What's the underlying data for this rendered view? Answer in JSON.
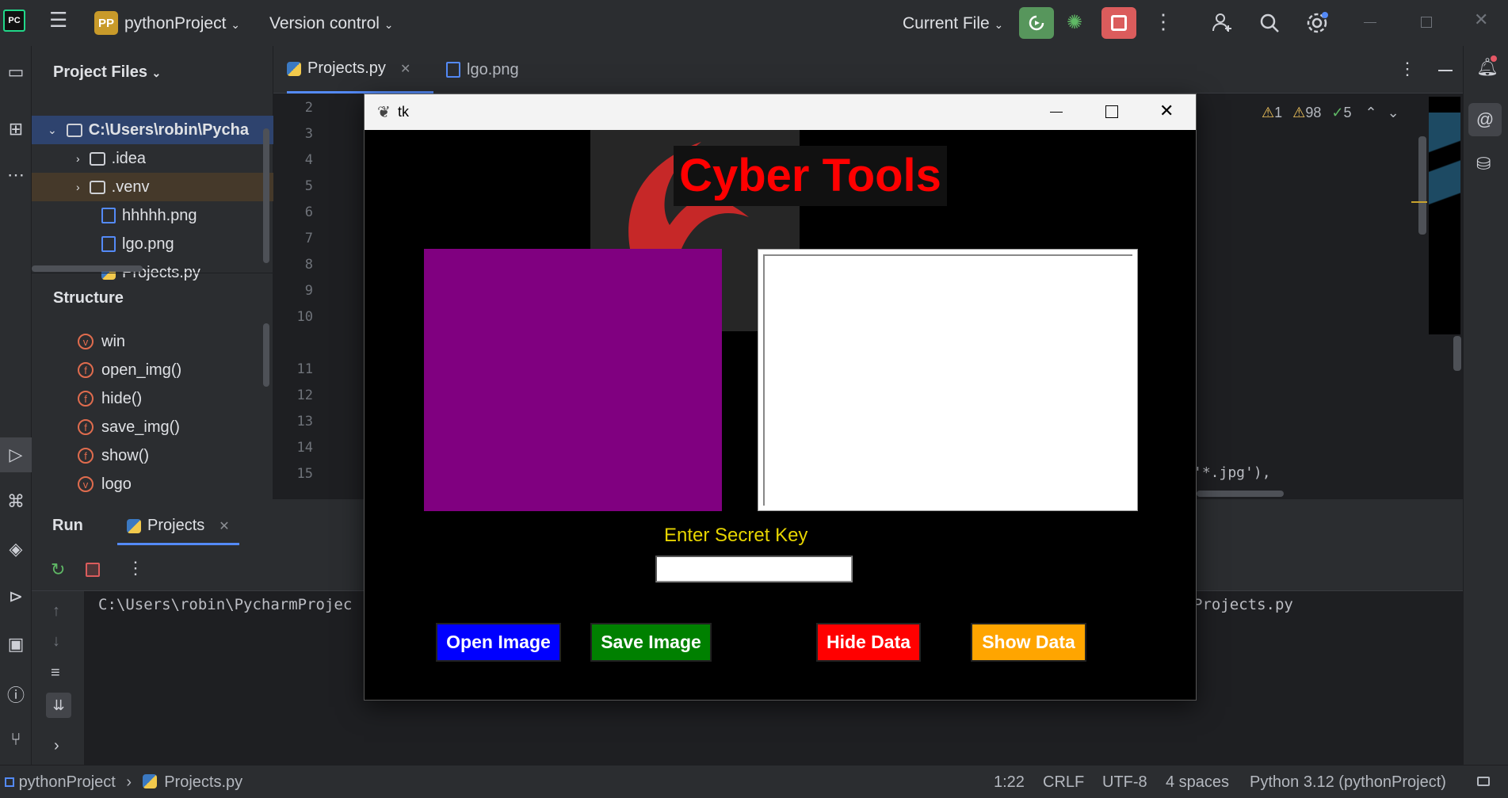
{
  "titlebar": {
    "project_badge": "PP",
    "project_name": "pythonProject",
    "vcs_label": "Version control",
    "run_config": "Current File",
    "icons": [
      "pycharm-logo-icon",
      "hamburger-menu-icon",
      "rerun-icon",
      "debug-icon",
      "stop-icon",
      "more-vertical-icon",
      "add-user-icon",
      "search-icon",
      "settings-icon",
      "minimize-icon",
      "restore-icon",
      "close-icon"
    ]
  },
  "project_panel": {
    "title": "Project Files",
    "root": "C:\\Users\\robin\\Pycha",
    "items": [
      ".idea",
      ".venv",
      "hhhhh.png",
      "lgo.png",
      "Projects.py"
    ]
  },
  "structure_panel": {
    "title": "Structure",
    "items": [
      {
        "kind": "v",
        "name": "win"
      },
      {
        "kind": "f",
        "name": "open_img()"
      },
      {
        "kind": "f",
        "name": "hide()"
      },
      {
        "kind": "f",
        "name": "save_img()"
      },
      {
        "kind": "f",
        "name": "show()"
      },
      {
        "kind": "v",
        "name": "logo"
      }
    ]
  },
  "editor": {
    "tabs": [
      {
        "label": "Projects.py",
        "active": true
      },
      {
        "label": "lgo.png",
        "active": false
      }
    ],
    "line_numbers": [
      "2",
      "3",
      "4",
      "5",
      "6",
      "7",
      "8",
      "9",
      "10",
      "11",
      "12",
      "13",
      "14",
      "15"
    ],
    "inspections": {
      "warnings_a": "1",
      "warnings_b": "98",
      "ok": "5"
    },
    "code_tail": "'*.jpg'),"
  },
  "run_panel": {
    "title": "Run",
    "tab_label": "Projects",
    "output_left": "C:\\Users\\robin\\PycharmProjec",
    "output_right": "Projects.py"
  },
  "statusbar": {
    "breadcrumb_project": "pythonProject",
    "breadcrumb_file": "Projects.py",
    "position": "1:22",
    "line_sep": "CRLF",
    "encoding": "UTF-8",
    "indent": "4 spaces",
    "interpreter": "Python 3.12 (pythonProject)"
  },
  "tk_window": {
    "title": "tk",
    "heading": "Cyber Tools",
    "key_label": "Enter Secret Key",
    "key_value": "",
    "buttons": {
      "open": "Open Image",
      "save": "Save Image",
      "hide": "Hide Data",
      "show": "Show Data"
    },
    "colors": {
      "open": "#0000ff",
      "save": "#008000",
      "hide": "#ff0000",
      "show": "#ffa500",
      "heading": "#ff0000",
      "image_box": "#800080",
      "key_label": "#e6d400"
    }
  }
}
